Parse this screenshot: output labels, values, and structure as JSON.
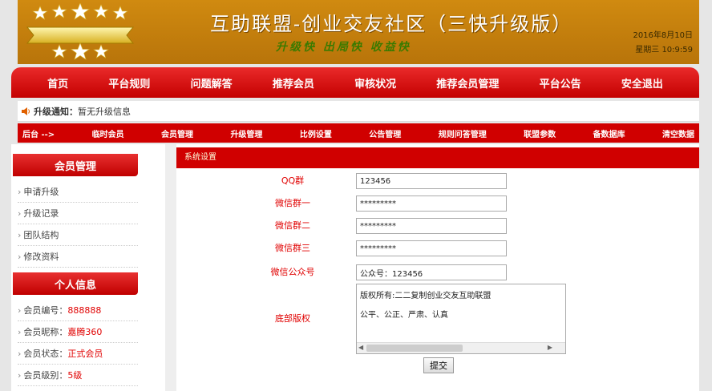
{
  "header": {
    "title": "互助联盟-创业交友社区（三快升级版）",
    "slogan": "升级快 出局快 收益快",
    "date": "2016年8月10日",
    "time": "星期三 10:9:59"
  },
  "main_nav": [
    {
      "label": "首页"
    },
    {
      "label": "平台规则"
    },
    {
      "label": "问题解答"
    },
    {
      "label": "推荐会员"
    },
    {
      "label": "审核状况"
    },
    {
      "label": "推荐会员管理"
    },
    {
      "label": "平台公告"
    },
    {
      "label": "安全退出"
    }
  ],
  "notice": {
    "label": "升级通知：",
    "text": "暂无升级信息"
  },
  "sub_nav": [
    {
      "label": "后台 -->"
    },
    {
      "label": "临时会员"
    },
    {
      "label": "会员管理"
    },
    {
      "label": "升级管理"
    },
    {
      "label": "比例设置"
    },
    {
      "label": "公告管理"
    },
    {
      "label": "规则问答管理"
    },
    {
      "label": "联盟参数"
    },
    {
      "label": "备数据库"
    },
    {
      "label": "清空数据"
    }
  ],
  "sidebar": {
    "member_title": "会员管理",
    "member_links": [
      {
        "label": "申请升级"
      },
      {
        "label": "升级记录"
      },
      {
        "label": "团队结构"
      },
      {
        "label": "修改资料"
      }
    ],
    "info_title": "个人信息",
    "info_items": [
      {
        "label": "会员编号：",
        "value": "888888"
      },
      {
        "label": "会员昵称：",
        "value": "嘉腾360"
      },
      {
        "label": "会员状态：",
        "value": "正式会员"
      },
      {
        "label": "会员级别：",
        "value": "5级"
      }
    ]
  },
  "content": {
    "section_title": "系统设置",
    "fields": [
      {
        "label": "QQ群",
        "value": "123456"
      },
      {
        "label": "微信群一",
        "value": "*********"
      },
      {
        "label": "微信群二",
        "value": "*********"
      },
      {
        "label": "微信群三",
        "value": "*********"
      },
      {
        "label": "微信公众号",
        "value": "公众号：123456"
      }
    ],
    "footer_label": "底部版权",
    "footer_text": "版权所有:二二复制创业交友互助联盟\n公平、公正、严肃、认真",
    "submit_label": "提交"
  },
  "colors": {
    "header_bg": "#c6800a",
    "nav_red": "#d00000",
    "label_red": "#e00000",
    "slogan_green": "#3a7a00"
  }
}
